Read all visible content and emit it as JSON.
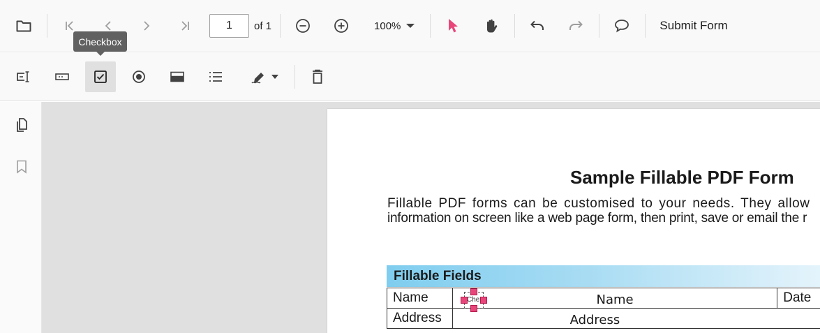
{
  "toolbar": {
    "current_page": "1",
    "page_count_label": "of 1",
    "zoom_label": "100%",
    "submit_label": "Submit Form"
  },
  "tooltip": {
    "text": "Checkbox"
  },
  "document": {
    "title": "Sample Fillable PDF Form",
    "description_line1": "Fillable PDF forms can be customised to your needs. They allow",
    "description_line2": "information on screen like a web page form, then print, save or email the r",
    "section_header": "Fillable Fields",
    "rows": [
      {
        "label": "Name",
        "value": "Name",
        "extra_label": "Date"
      },
      {
        "label": "Address",
        "value": "Address"
      }
    ],
    "checkbox_field_text": "Che"
  },
  "colors": {
    "accent": "#e8457a",
    "toolbar_bg": "#f9f9f9",
    "viewer_bg": "#e0e0e0",
    "section_header_start": "#7fcdef"
  }
}
